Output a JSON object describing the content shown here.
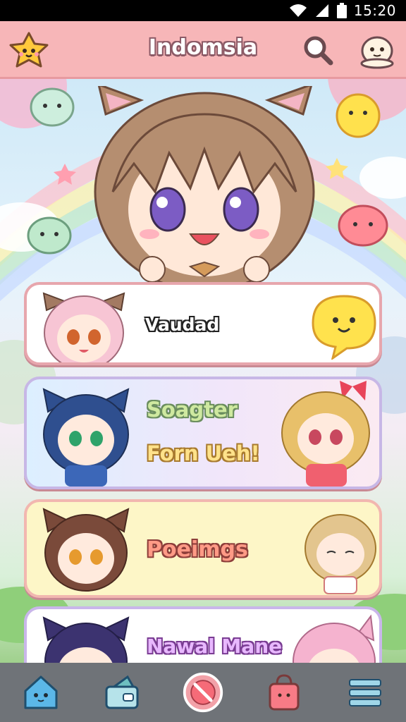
{
  "status_bar": {
    "time": "15:20",
    "icons": [
      "wifi-icon",
      "signal-icon",
      "battery-icon"
    ]
  },
  "app_bar": {
    "title": "Indomsia",
    "logo_icon": "star-mascot-icon",
    "search_icon": "search-icon",
    "profile_icon": "mascot-profile-icon",
    "background_color": "#f7b6b8"
  },
  "cards": [
    {
      "labels": [
        "Vaudad"
      ]
    },
    {
      "labels": [
        "Soagter",
        "Forn Ueh!"
      ]
    },
    {
      "labels": [
        "Poeimgs"
      ]
    },
    {
      "labels": [
        "Nawal Mane"
      ]
    }
  ],
  "bottom_nav": {
    "items": [
      {
        "icon": "mascot-home-icon"
      },
      {
        "icon": "wallet-icon"
      },
      {
        "icon": "no-entry-icon"
      },
      {
        "icon": "shopping-bag-icon"
      },
      {
        "icon": "menu-icon"
      }
    ],
    "background_color": "#6f7378"
  }
}
